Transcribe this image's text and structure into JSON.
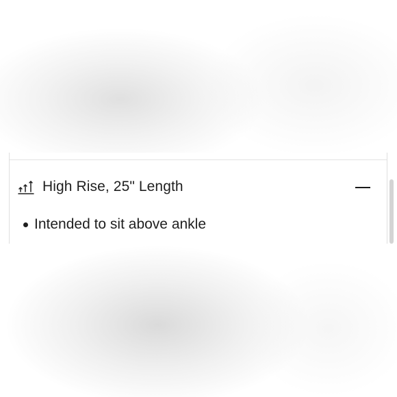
{
  "accordion": {
    "icon": "high-rise-arrows-icon",
    "title": "High Rise, 25\" Length",
    "toggle_icon": "minus-icon",
    "expanded": true,
    "details": [
      "Intended to sit above ankle"
    ]
  },
  "colors": {
    "text": "#1f1f1f",
    "border": "#dedede",
    "background": "#ffffff"
  }
}
